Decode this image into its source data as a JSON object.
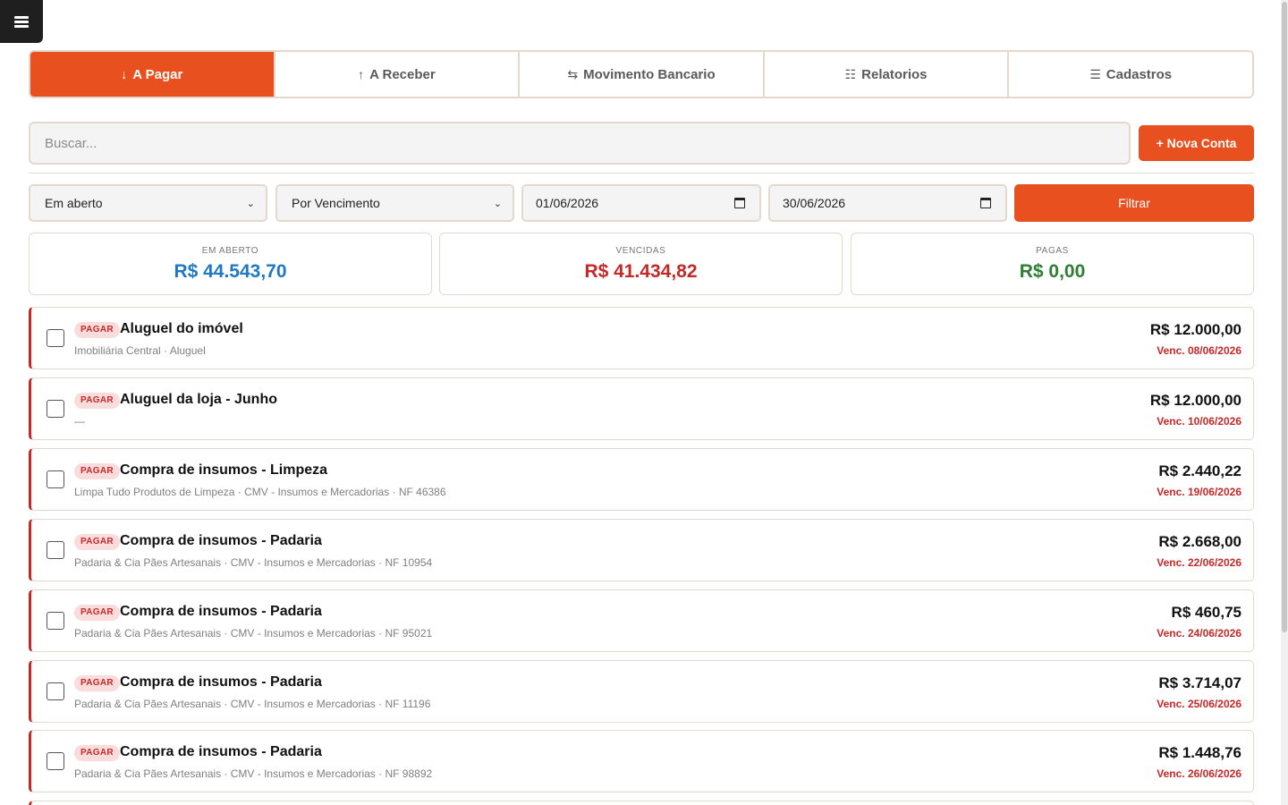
{
  "tabs": [
    {
      "icon": "↓",
      "label": "A Pagar",
      "active": true
    },
    {
      "icon": "↑",
      "label": "A Receber",
      "active": false
    },
    {
      "icon": "⇆",
      "label": "Movimento Bancario",
      "active": false
    },
    {
      "icon": "☷",
      "label": "Relatorios",
      "active": false
    },
    {
      "icon": "☰",
      "label": "Cadastros",
      "active": false
    }
  ],
  "search": {
    "placeholder": "Buscar..."
  },
  "new_button": "+ Nova Conta",
  "filters": {
    "status": "Em aberto",
    "order": "Por Vencimento",
    "date_from": "01/06/2026",
    "date_to": "30/06/2026",
    "button": "Filtrar"
  },
  "summary": [
    {
      "label": "EM ABERTO",
      "value": "R$ 44.543,70",
      "color": "#1f78c1"
    },
    {
      "label": "VENCIDAS",
      "value": "R$ 41.434,82",
      "color": "#c62828"
    },
    {
      "label": "PAGAS",
      "value": "R$ 0,00",
      "color": "#2e7d32"
    }
  ],
  "bills": [
    {
      "badge": "PAGAR",
      "title": "Aluguel do imóvel",
      "sub": "Imobiliária Central · Aluguel",
      "amount": "R$ 12.000,00",
      "due": "Venc. 08/06/2026"
    },
    {
      "badge": "PAGAR",
      "title": "Aluguel da loja - Junho",
      "sub": "—",
      "amount": "R$ 12.000,00",
      "due": "Venc. 10/06/2026"
    },
    {
      "badge": "PAGAR",
      "title": "Compra de insumos - Limpeza",
      "sub": "Limpa Tudo Produtos de Limpeza · CMV - Insumos e Mercadorias · NF 46386",
      "amount": "R$ 2.440,22",
      "due": "Venc. 19/06/2026"
    },
    {
      "badge": "PAGAR",
      "title": "Compra de insumos - Padaria",
      "sub": "Padaria & Cia Pães Artesanais · CMV - Insumos e Mercadorias · NF 10954",
      "amount": "R$ 2.668,00",
      "due": "Venc. 22/06/2026"
    },
    {
      "badge": "PAGAR",
      "title": "Compra de insumos - Padaria",
      "sub": "Padaria & Cia Pães Artesanais · CMV - Insumos e Mercadorias · NF 95021",
      "amount": "R$ 460,75",
      "due": "Venc. 24/06/2026"
    },
    {
      "badge": "PAGAR",
      "title": "Compra de insumos - Padaria",
      "sub": "Padaria & Cia Pães Artesanais · CMV - Insumos e Mercadorias · NF 11196",
      "amount": "R$ 3.714,07",
      "due": "Venc. 25/06/2026"
    },
    {
      "badge": "PAGAR",
      "title": "Compra de insumos - Padaria",
      "sub": "Padaria & Cia Pães Artesanais · CMV - Insumos e Mercadorias · NF 98892",
      "amount": "R$ 1.448,76",
      "due": "Venc. 26/06/2026"
    }
  ],
  "colors": {
    "accent": "#e8501f",
    "danger": "#c62828"
  }
}
